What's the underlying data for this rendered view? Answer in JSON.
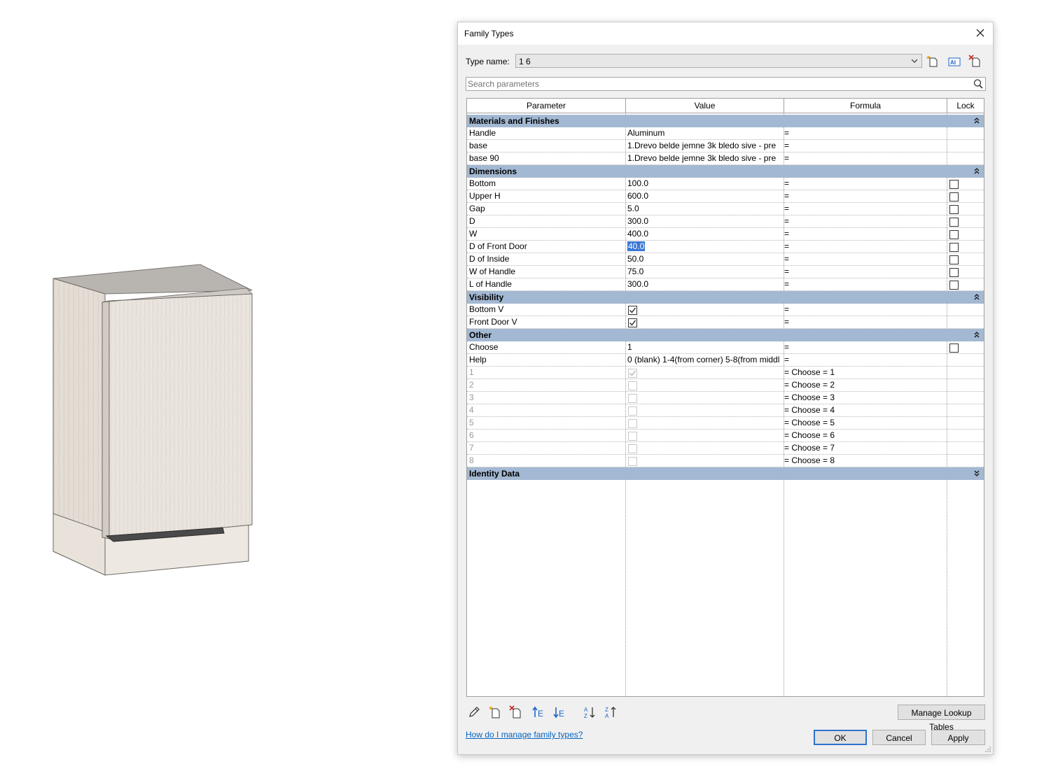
{
  "dialog": {
    "title": "Family Types",
    "type_name_label": "Type name:",
    "type_name_value": "1 6",
    "search_placeholder": "Search parameters"
  },
  "table": {
    "headers": [
      "Parameter",
      "Value",
      "Formula",
      "Lock"
    ],
    "groups": [
      {
        "name": "Materials and Finishes",
        "collapsed": false,
        "rows": [
          {
            "param": "Handle",
            "value": "Aluminum",
            "formula": "="
          },
          {
            "param": "base",
            "value": "1.Drevo belde jemne 3k bledo sive - pre",
            "formula": "="
          },
          {
            "param": "base 90",
            "value": "1.Drevo belde jemne 3k bledo sive - pre",
            "formula": "="
          }
        ]
      },
      {
        "name": "Dimensions",
        "collapsed": false,
        "rows": [
          {
            "param": "Bottom",
            "value": "100.0",
            "formula": "=",
            "lock": false
          },
          {
            "param": "Upper H",
            "value": "600.0",
            "formula": "=",
            "lock": false
          },
          {
            "param": "Gap",
            "value": "5.0",
            "formula": "=",
            "lock": false
          },
          {
            "param": "D",
            "value": "300.0",
            "formula": "=",
            "lock": false
          },
          {
            "param": "W",
            "value": "400.0",
            "formula": "=",
            "lock": false
          },
          {
            "param": "D of Front Door",
            "value": "40.0",
            "formula": "=",
            "lock": false,
            "selected": true
          },
          {
            "param": "D of Inside",
            "value": "50.0",
            "formula": "=",
            "lock": false
          },
          {
            "param": "W of Handle",
            "value": "75.0",
            "formula": "=",
            "lock": false
          },
          {
            "param": "L of Handle",
            "value": "300.0",
            "formula": "=",
            "lock": false
          }
        ]
      },
      {
        "name": "Visibility",
        "collapsed": false,
        "rows": [
          {
            "param": "Bottom V",
            "check": true,
            "formula": "="
          },
          {
            "param": "Front Door V",
            "check": true,
            "formula": "="
          }
        ]
      },
      {
        "name": "Other",
        "collapsed": false,
        "rows": [
          {
            "param": "Choose",
            "value": "1",
            "formula": "=",
            "lock": false
          },
          {
            "param": "Help",
            "value": "0 (blank) 1-4(from corner) 5-8(from middl",
            "formula": "="
          },
          {
            "param": "1",
            "check": true,
            "disabled": true,
            "formula": "= Choose = 1"
          },
          {
            "param": "2",
            "check": false,
            "disabled": true,
            "formula": "= Choose = 2"
          },
          {
            "param": "3",
            "check": false,
            "disabled": true,
            "formula": "= Choose = 3"
          },
          {
            "param": "4",
            "check": false,
            "disabled": true,
            "formula": "= Choose = 4"
          },
          {
            "param": "5",
            "check": false,
            "disabled": true,
            "formula": "= Choose = 5"
          },
          {
            "param": "6",
            "check": false,
            "disabled": true,
            "formula": "= Choose = 6"
          },
          {
            "param": "7",
            "check": false,
            "disabled": true,
            "formula": "= Choose = 7"
          },
          {
            "param": "8",
            "check": false,
            "disabled": true,
            "formula": "= Choose = 8"
          }
        ]
      },
      {
        "name": "Identity Data",
        "collapsed": true,
        "rows": []
      }
    ]
  },
  "toolbar_icons": [
    "pencil-icon",
    "new-parameter-icon",
    "delete-parameter-icon",
    "move-up-icon",
    "move-down-icon",
    "sort-ascending-icon",
    "sort-descending-icon"
  ],
  "buttons": {
    "manage_lookup": "Manage Lookup Tables",
    "ok": "OK",
    "cancel": "Cancel",
    "apply": "Apply"
  },
  "help_link": "How do I manage family types?",
  "colors": {
    "group_header": "#a3b8d2",
    "selection": "#3a77d6",
    "link": "#0563c1"
  }
}
